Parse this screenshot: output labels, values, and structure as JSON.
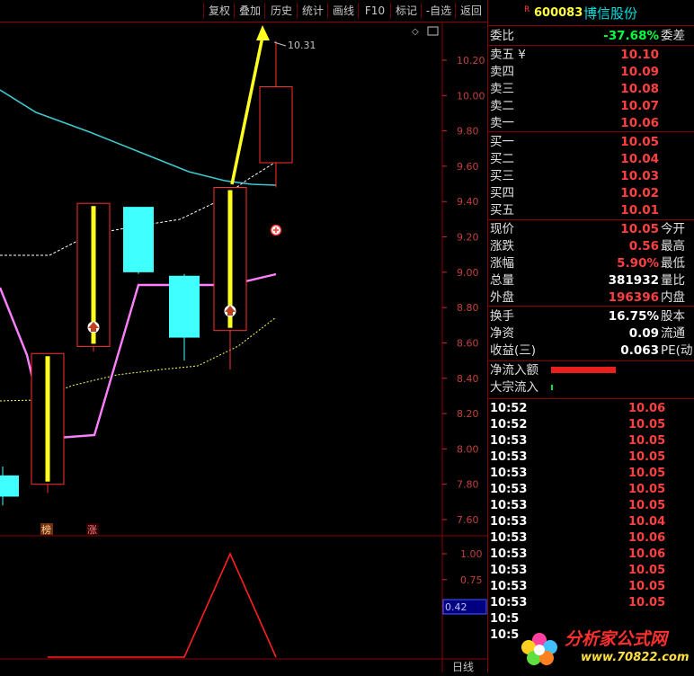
{
  "toolbar": {
    "buttons": [
      "复权",
      "叠加",
      "历史",
      "统计",
      "画线",
      "F10",
      "标记",
      "-自选",
      "返回"
    ]
  },
  "chart": {
    "price_axis": [
      "10.20",
      "10.00",
      "9.80",
      "9.60",
      "9.40",
      "9.20",
      "9.00",
      "8.80",
      "8.60",
      "8.40",
      "8.20",
      "8.00",
      "7.80",
      "7.60"
    ],
    "high_label": "10.31",
    "badges": [
      "榜",
      "涨"
    ],
    "sub_axis": [
      "1.00",
      "0.75",
      "0.50"
    ],
    "sub_current": "0.42",
    "period_label": "日线",
    "colors": {
      "up": "#ff3030",
      "down": "#40ffff",
      "yellow": "#ffff20",
      "pink": "#ff80ff",
      "teal": "#40c8d0",
      "sub": "#ff2020"
    }
  },
  "chart_data": {
    "type": "candlestick",
    "candles": [
      {
        "open": 7.8,
        "close": 8.54,
        "high": 8.54,
        "low": 7.75
      },
      {
        "open": 8.58,
        "close": 9.39,
        "high": 9.39,
        "low": 8.55
      },
      {
        "open": 9.37,
        "close": 9.0,
        "high": 9.37,
        "low": 8.99
      },
      {
        "open": 8.98,
        "close": 8.63,
        "high": 8.99,
        "low": 8.5
      },
      {
        "open": 8.67,
        "close": 9.48,
        "high": 9.48,
        "low": 8.45
      },
      {
        "open": 9.62,
        "close": 10.05,
        "high": 10.31,
        "low": 9.48
      }
    ],
    "ylim": [
      7.6,
      10.2
    ],
    "sub_series": {
      "values": [
        0,
        0,
        0,
        0,
        1,
        0
      ]
    },
    "sub_ylim": [
      0,
      1.0
    ]
  },
  "panel": {
    "code_mark": "R",
    "code": "600083",
    "name": "博信股份",
    "weibi_label": "委比",
    "weibi_value": "-37.68%",
    "weicha_label": "委差",
    "asks": [
      {
        "label": "卖五",
        "extra": "¥",
        "price": "10.10"
      },
      {
        "label": "卖四",
        "extra": "",
        "price": "10.09"
      },
      {
        "label": "卖三",
        "extra": "",
        "price": "10.08"
      },
      {
        "label": "卖二",
        "extra": "",
        "price": "10.07"
      },
      {
        "label": "卖一",
        "extra": "",
        "price": "10.06"
      }
    ],
    "bids": [
      {
        "label": "买一",
        "price": "10.05"
      },
      {
        "label": "买二",
        "price": "10.04"
      },
      {
        "label": "买三",
        "price": "10.03"
      },
      {
        "label": "买四",
        "price": "10.02"
      },
      {
        "label": "买五",
        "price": "10.01"
      }
    ],
    "stats": [
      {
        "label": "现价",
        "value": "10.05",
        "tail": "今开",
        "color": "red"
      },
      {
        "label": "涨跌",
        "value": "0.56",
        "tail": "最高",
        "color": "red"
      },
      {
        "label": "涨幅",
        "value": "5.90%",
        "tail": "最低",
        "color": "red"
      },
      {
        "label": "总量",
        "value": "381932",
        "tail": "量比",
        "color": "white"
      },
      {
        "label": "外盘",
        "value": "196396",
        "tail": "内盘",
        "color": "red"
      }
    ],
    "stats2": [
      {
        "label": "换手",
        "value": "16.75%",
        "tail": "股本",
        "color": "white"
      },
      {
        "label": "净资",
        "value": "0.09",
        "tail": "流通",
        "color": "white"
      },
      {
        "label": "收益(三)",
        "value": "0.063",
        "tail": "PE(动",
        "color": "white"
      }
    ],
    "flow": [
      {
        "label": "净流入额"
      },
      {
        "label": "大宗流入"
      }
    ],
    "ticks": [
      {
        "time": "10:52",
        "price": "10.06"
      },
      {
        "time": "10:52",
        "price": "10.05"
      },
      {
        "time": "10:53",
        "price": "10.05"
      },
      {
        "time": "10:53",
        "price": "10.05"
      },
      {
        "time": "10:53",
        "price": "10.05"
      },
      {
        "time": "10:53",
        "price": "10.05"
      },
      {
        "time": "10:53",
        "price": "10.05"
      },
      {
        "time": "10:53",
        "price": "10.04"
      },
      {
        "time": "10:53",
        "price": "10.06"
      },
      {
        "time": "10:53",
        "price": "10.06"
      },
      {
        "time": "10:53",
        "price": "10.05"
      },
      {
        "time": "10:53",
        "price": "10.05"
      },
      {
        "time": "10:53",
        "price": "10.05"
      },
      {
        "time": "10:5",
        "price": ""
      },
      {
        "time": "10:5",
        "price": ""
      }
    ]
  },
  "watermark": {
    "text": "分析家公式网",
    "url": "www.70822.com"
  }
}
